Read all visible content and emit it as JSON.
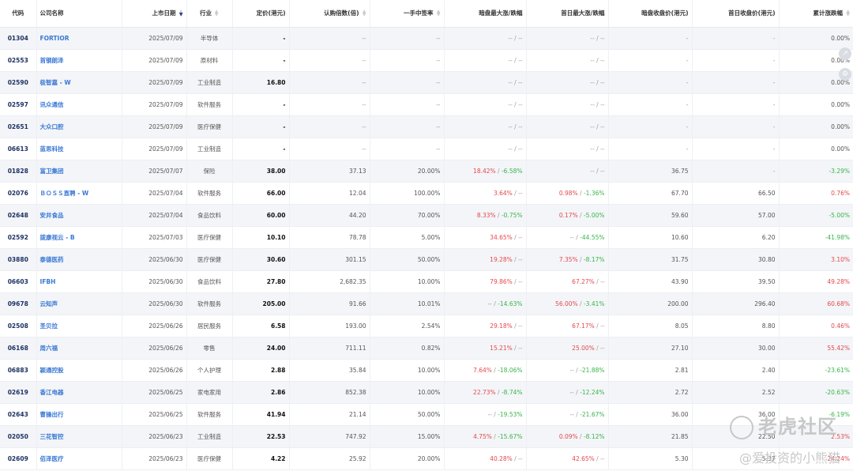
{
  "headers": [
    "代码",
    "公司名称",
    "上市日期",
    "行业",
    "定价(港元)",
    "认购倍数(倍)",
    "一手中签率",
    "暗盘最大涨/跌幅",
    "首日最大涨/跌幅",
    "暗盘收盘价(港元)",
    "首日收盘价(港元)",
    "累计涨跌幅"
  ],
  "sort_column": "上市日期",
  "colors": {
    "up": "#e5484d",
    "down": "#39b54a",
    "code": "#1e3262",
    "name": "#3a78d4"
  },
  "rows": [
    {
      "code": "01304",
      "name": "FORTIOR",
      "date": "2025/07/09",
      "industry": "半导体",
      "price": "-",
      "sub": "--",
      "rate": "--",
      "dark_up": "--",
      "dark_down": "--",
      "first_up": "--",
      "first_down": "--",
      "dark_close": "-",
      "first_close": "-",
      "cum": "0.00%",
      "cum_dir": "flat"
    },
    {
      "code": "02553",
      "name": "首钢朗泽",
      "date": "2025/07/09",
      "industry": "原材料",
      "price": "-",
      "sub": "--",
      "rate": "--",
      "dark_up": "--",
      "dark_down": "--",
      "first_up": "--",
      "first_down": "--",
      "dark_close": "-",
      "first_close": "-",
      "cum": "0.00%",
      "cum_dir": "flat"
    },
    {
      "code": "02590",
      "name": "极智嘉 - W",
      "date": "2025/07/09",
      "industry": "工业制造",
      "price": "16.80",
      "sub": "--",
      "rate": "--",
      "dark_up": "--",
      "dark_down": "--",
      "first_up": "--",
      "first_down": "--",
      "dark_close": "-",
      "first_close": "-",
      "cum": "0.00%",
      "cum_dir": "flat"
    },
    {
      "code": "02597",
      "name": "讯众通信",
      "date": "2025/07/09",
      "industry": "软件服务",
      "price": "-",
      "sub": "--",
      "rate": "--",
      "dark_up": "--",
      "dark_down": "--",
      "first_up": "--",
      "first_down": "--",
      "dark_close": "-",
      "first_close": "-",
      "cum": "0.00%",
      "cum_dir": "flat"
    },
    {
      "code": "02651",
      "name": "大众口腔",
      "date": "2025/07/09",
      "industry": "医疗保健",
      "price": "-",
      "sub": "--",
      "rate": "--",
      "dark_up": "--",
      "dark_down": "--",
      "first_up": "--",
      "first_down": "--",
      "dark_close": "-",
      "first_close": "-",
      "cum": "0.00%",
      "cum_dir": "flat"
    },
    {
      "code": "06613",
      "name": "蓝思科技",
      "date": "2025/07/09",
      "industry": "工业制造",
      "price": "-",
      "sub": "--",
      "rate": "--",
      "dark_up": "--",
      "dark_down": "--",
      "first_up": "--",
      "first_down": "--",
      "dark_close": "-",
      "first_close": "-",
      "cum": "0.00%",
      "cum_dir": "flat"
    },
    {
      "code": "01828",
      "name": "富卫集团",
      "date": "2025/07/07",
      "industry": "保险",
      "price": "38.00",
      "sub": "37.13",
      "rate": "20.00%",
      "dark_up": "18.42%",
      "dark_down": "-6.58%",
      "first_up": "--",
      "first_down": "--",
      "dark_close": "36.75",
      "first_close": "-",
      "cum": "-3.29%",
      "cum_dir": "down"
    },
    {
      "code": "02076",
      "name": "ＢＯＳＳ直聘 - W",
      "date": "2025/07/04",
      "industry": "软件服务",
      "price": "66.00",
      "sub": "12.04",
      "rate": "100.00%",
      "dark_up": "3.64%",
      "dark_down": "--",
      "first_up": "0.98%",
      "first_down": "-1.36%",
      "dark_close": "67.70",
      "first_close": "66.50",
      "cum": "0.76%",
      "cum_dir": "up"
    },
    {
      "code": "02648",
      "name": "安井食品",
      "date": "2025/07/04",
      "industry": "食品饮料",
      "price": "60.00",
      "sub": "44.20",
      "rate": "70.00%",
      "dark_up": "8.33%",
      "dark_down": "-0.75%",
      "first_up": "0.17%",
      "first_down": "-5.00%",
      "dark_close": "59.60",
      "first_close": "57.00",
      "cum": "-5.00%",
      "cum_dir": "down"
    },
    {
      "code": "02592",
      "name": "拨康视云 - B",
      "date": "2025/07/03",
      "industry": "医疗保健",
      "price": "10.10",
      "sub": "78.78",
      "rate": "5.00%",
      "dark_up": "34.65%",
      "dark_down": "--",
      "first_up": "--",
      "first_down": "-44.55%",
      "dark_close": "10.60",
      "first_close": "6.20",
      "cum": "-41.98%",
      "cum_dir": "down"
    },
    {
      "code": "03880",
      "name": "泰德医药",
      "date": "2025/06/30",
      "industry": "医疗保健",
      "price": "30.60",
      "sub": "301.15",
      "rate": "50.00%",
      "dark_up": "19.28%",
      "dark_down": "--",
      "first_up": "7.35%",
      "first_down": "-8.17%",
      "dark_close": "31.75",
      "first_close": "30.80",
      "cum": "3.10%",
      "cum_dir": "up"
    },
    {
      "code": "06603",
      "name": "IFBH",
      "date": "2025/06/30",
      "industry": "食品饮料",
      "price": "27.80",
      "sub": "2,682.35",
      "rate": "10.00%",
      "dark_up": "79.86%",
      "dark_down": "--",
      "first_up": "67.27%",
      "first_down": "--",
      "dark_close": "43.90",
      "first_close": "39.50",
      "cum": "49.28%",
      "cum_dir": "up"
    },
    {
      "code": "09678",
      "name": "云知声",
      "date": "2025/06/30",
      "industry": "软件服务",
      "price": "205.00",
      "sub": "91.66",
      "rate": "10.01%",
      "dark_up": "--",
      "dark_down": "-14.63%",
      "first_up": "56.00%",
      "first_down": "-3.41%",
      "dark_close": "200.00",
      "first_close": "296.40",
      "cum": "60.68%",
      "cum_dir": "up"
    },
    {
      "code": "02508",
      "name": "圣贝拉",
      "date": "2025/06/26",
      "industry": "居民服务",
      "price": "6.58",
      "sub": "193.00",
      "rate": "2.54%",
      "dark_up": "29.18%",
      "dark_down": "--",
      "first_up": "67.17%",
      "first_down": "--",
      "dark_close": "8.05",
      "first_close": "8.80",
      "cum": "0.46%",
      "cum_dir": "up"
    },
    {
      "code": "06168",
      "name": "周六福",
      "date": "2025/06/26",
      "industry": "零售",
      "price": "24.00",
      "sub": "711.11",
      "rate": "0.82%",
      "dark_up": "15.21%",
      "dark_down": "--",
      "first_up": "25.00%",
      "first_down": "--",
      "dark_close": "27.10",
      "first_close": "30.00",
      "cum": "55.42%",
      "cum_dir": "up"
    },
    {
      "code": "06883",
      "name": "颖通控股",
      "date": "2025/06/26",
      "industry": "个人护理",
      "price": "2.88",
      "sub": "35.84",
      "rate": "10.00%",
      "dark_up": "7.64%",
      "dark_down": "-18.06%",
      "first_up": "--",
      "first_down": "-21.88%",
      "dark_close": "2.81",
      "first_close": "2.40",
      "cum": "-23.61%",
      "cum_dir": "down"
    },
    {
      "code": "02619",
      "name": "香江电器",
      "date": "2025/06/25",
      "industry": "家电家用",
      "price": "2.86",
      "sub": "852.38",
      "rate": "10.00%",
      "dark_up": "22.73%",
      "dark_down": "-8.74%",
      "first_up": "--",
      "first_down": "-12.24%",
      "dark_close": "2.72",
      "first_close": "2.52",
      "cum": "-20.63%",
      "cum_dir": "down"
    },
    {
      "code": "02643",
      "name": "曹操出行",
      "date": "2025/06/25",
      "industry": "软件服务",
      "price": "41.94",
      "sub": "21.14",
      "rate": "50.00%",
      "dark_up": "--",
      "dark_down": "-19.53%",
      "first_up": "--",
      "first_down": "-21.67%",
      "dark_close": "36.00",
      "first_close": "36.00",
      "cum": "-6.19%",
      "cum_dir": "down"
    },
    {
      "code": "02050",
      "name": "三花智控",
      "date": "2025/06/23",
      "industry": "工业制造",
      "price": "22.53",
      "sub": "747.92",
      "rate": "15.00%",
      "dark_up": "4.75%",
      "dark_down": "-15.67%",
      "first_up": "0.09%",
      "first_down": "-8.12%",
      "dark_close": "21.85",
      "first_close": "22.50",
      "cum": "2.53%",
      "cum_dir": "up"
    },
    {
      "code": "02609",
      "name": "佰泽医疗",
      "date": "2025/06/23",
      "industry": "医疗保健",
      "price": "4.22",
      "sub": "25.92",
      "rate": "20.00%",
      "dark_up": "40.28%",
      "dark_down": "--",
      "first_up": "42.65%",
      "first_down": "--",
      "dark_close": "5.30",
      "first_close": "5.37",
      "cum": "24.24%",
      "cum_dir": "up"
    }
  ],
  "watermark": {
    "brand": "老虎社区",
    "user": "@爱投资的小熊猫"
  }
}
